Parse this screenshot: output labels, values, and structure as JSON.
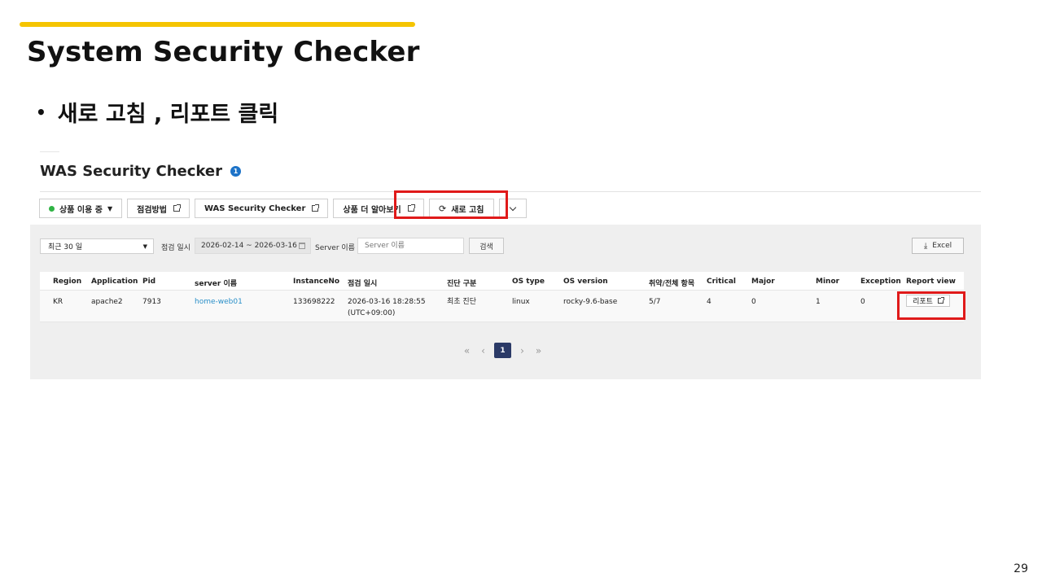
{
  "slide": {
    "title": "System Security Checker",
    "bullet": "새로 고침 , 리포트 클릭",
    "page_number": "29",
    "accent_color": "#f5c400",
    "highlight_color": "#e01a1a"
  },
  "app": {
    "title": "WAS Security Checker",
    "info_badge": "1",
    "toolbar": {
      "status_label": "상품 이용 중",
      "guide_label": "점검방법",
      "was_label": "WAS Security Checker",
      "more_label": "상품 더 알아보기",
      "refresh_label": "새로 고침"
    },
    "filters": {
      "period": "최근 30 일",
      "date_label": "점검 일시",
      "date_range": "2026-02-14 ~ 2026-03-16",
      "server_label": "Server 이름",
      "server_placeholder": "Server 이름",
      "search_label": "검색",
      "excel_label": "Excel"
    },
    "table": {
      "headers": {
        "region": "Region",
        "application": "Application",
        "pid": "Pid",
        "server": "server 이름",
        "instance": "InstanceNo",
        "date": "점검 일시",
        "diag": "진단 구분",
        "os_type": "OS type",
        "os_version": "OS version",
        "vuln": "취약/전체 항목",
        "critical": "Critical",
        "major": "Major",
        "minor": "Minor",
        "exception": "Exception",
        "report": "Report view"
      },
      "rows": [
        {
          "region": "KR",
          "application": "apache2",
          "pid": "7913",
          "server": "home-web01",
          "instance": "133698222",
          "date_line1": "2026-03-16 18:28:55",
          "date_line2": "(UTC+09:00)",
          "diag": "최초 진단",
          "os_type": "linux",
          "os_version": "rocky-9.6-base",
          "vuln": "5/7",
          "critical": "4",
          "major": "0",
          "minor": "1",
          "exception": "0",
          "report_label": "리포트"
        }
      ]
    },
    "pagination": {
      "current": "1"
    }
  }
}
